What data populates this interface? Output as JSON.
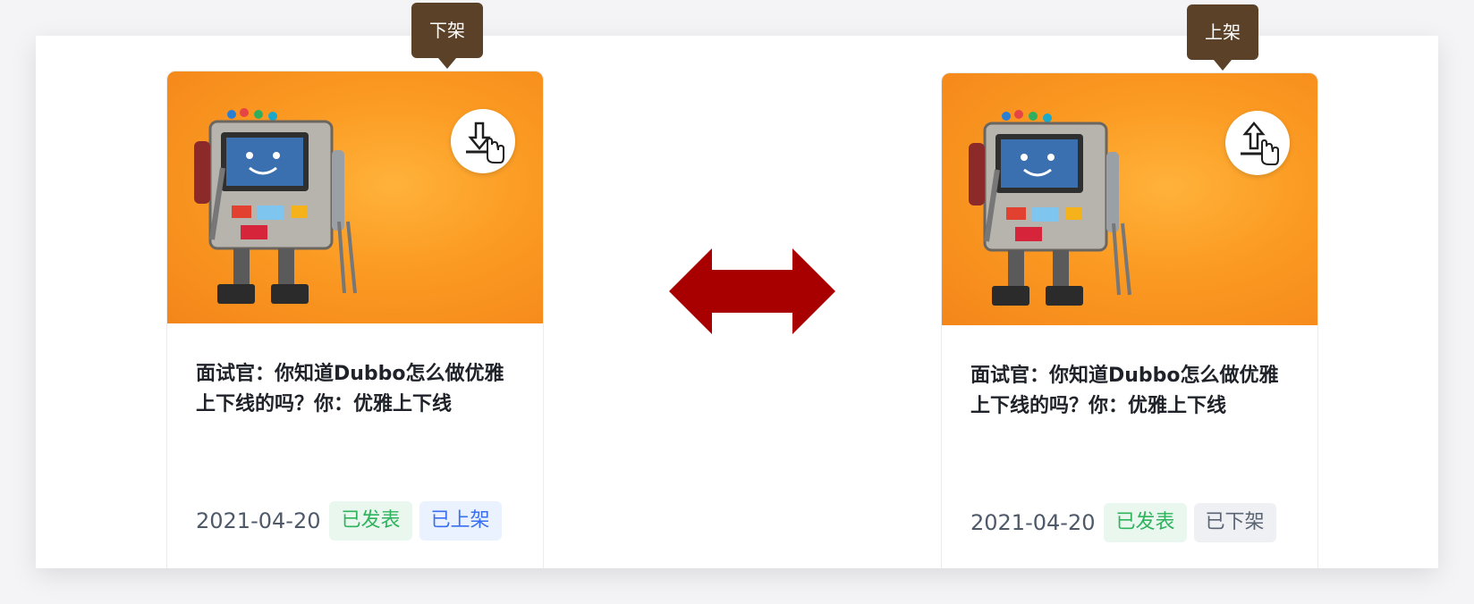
{
  "colors": {
    "accent_arrow": "#a80000",
    "tooltip_bg": "#5a4128",
    "cover_orange": "#f99a24",
    "tag_green": "#2fb45e",
    "tag_blue": "#3a6ff0",
    "tag_gray": "#5b6473"
  },
  "cards": [
    {
      "title": "面试官：你知道Dubbo怎么做优雅上下线的吗？你：优雅上下线",
      "date": "2021-04-20",
      "tags": [
        "已发表",
        "已上架"
      ],
      "action_icon": "download-icon",
      "tooltip": "下架"
    },
    {
      "title": "面试官：你知道Dubbo怎么做优雅上下线的吗？你：优雅上下线",
      "date": "2021-04-20",
      "tags": [
        "已发表",
        "已下架"
      ],
      "action_icon": "upload-icon",
      "tooltip": "上架"
    }
  ],
  "center_icon": "double-arrow-icon"
}
